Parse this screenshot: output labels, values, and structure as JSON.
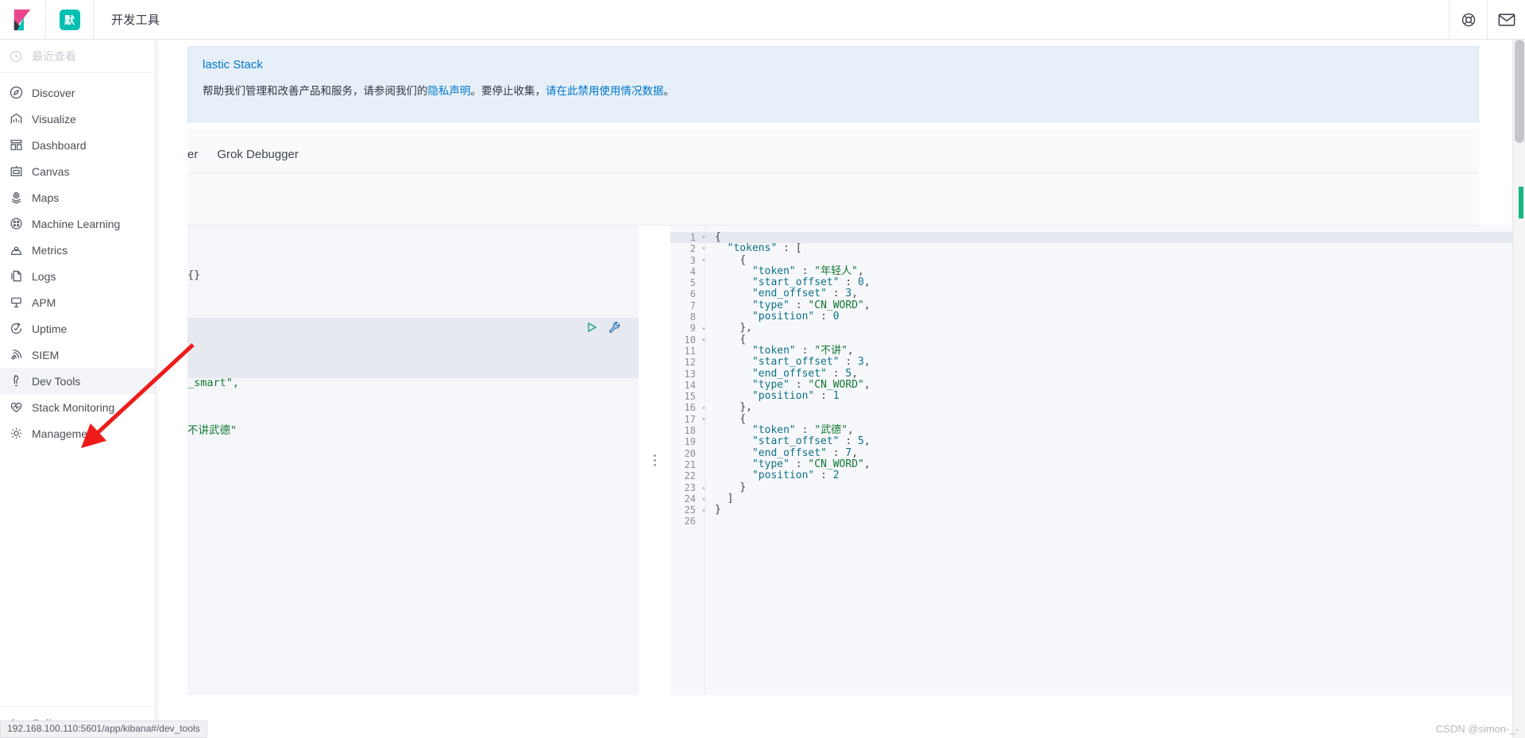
{
  "topbar": {
    "logo_name": "kibana-logo",
    "space_badge": "默",
    "app_title": "开发工具",
    "help_icon": "help-lifebuoy-icon",
    "mail_icon": "mail-icon"
  },
  "nav": {
    "recent_label": "最近查看",
    "recent_icon": "clock-icon",
    "items": [
      {
        "label": "Discover",
        "icon": "compass-icon",
        "active": false
      },
      {
        "label": "Visualize",
        "icon": "bar-chart-icon",
        "active": false
      },
      {
        "label": "Dashboard",
        "icon": "dashboard-icon",
        "active": false
      },
      {
        "label": "Canvas",
        "icon": "canvas-icon",
        "active": false
      },
      {
        "label": "Maps",
        "icon": "map-pin-icon",
        "active": false
      },
      {
        "label": "Machine Learning",
        "icon": "machine-learning-icon",
        "active": false
      },
      {
        "label": "Metrics",
        "icon": "metrics-icon",
        "active": false
      },
      {
        "label": "Logs",
        "icon": "logs-icon",
        "active": false
      },
      {
        "label": "APM",
        "icon": "apm-icon",
        "active": false
      },
      {
        "label": "Uptime",
        "icon": "uptime-icon",
        "active": false
      },
      {
        "label": "SIEM",
        "icon": "siem-icon",
        "active": false
      },
      {
        "label": "Dev Tools",
        "icon": "wrench-icon",
        "active": true
      },
      {
        "label": "Stack Monitoring",
        "icon": "heartbeat-icon",
        "active": false
      },
      {
        "label": "Management",
        "icon": "gear-icon",
        "active": false
      }
    ],
    "collapse_label": "Collapse",
    "collapse_icon": "arrow-left-icon"
  },
  "notice": {
    "title": "lastic Stack",
    "body_pre": "帮助我们管理和改善产品和服务，请参阅我们的",
    "link1": "隐私声明",
    "body_mid": "。要停止收集，",
    "link2": "请在此禁用使用情况数据",
    "body_post": "。"
  },
  "tabs": [
    {
      "label": "er",
      "active": false
    },
    {
      "label": "Grok Debugger",
      "active": false
    }
  ],
  "request_editor": {
    "empty_brace": "{}",
    "line1": "_smart\",",
    "line2": "不讲武德\"",
    "play_icon": "play-icon",
    "wrench_icon": "wrench-icon"
  },
  "response_editor": {
    "lines": [
      {
        "num": "1",
        "fold": "down",
        "text": "{",
        "hl": true
      },
      {
        "num": "2",
        "fold": "down",
        "text": "  \"tokens\" : ["
      },
      {
        "num": "3",
        "fold": "down",
        "text": "    {"
      },
      {
        "num": "4",
        "fold": "",
        "text": "      \"token\" : \"年轻人\","
      },
      {
        "num": "5",
        "fold": "",
        "text": "      \"start_offset\" : 0,"
      },
      {
        "num": "6",
        "fold": "",
        "text": "      \"end_offset\" : 3,"
      },
      {
        "num": "7",
        "fold": "",
        "text": "      \"type\" : \"CN_WORD\","
      },
      {
        "num": "8",
        "fold": "",
        "text": "      \"position\" : 0"
      },
      {
        "num": "9",
        "fold": "up",
        "text": "    },"
      },
      {
        "num": "10",
        "fold": "down",
        "text": "    {"
      },
      {
        "num": "11",
        "fold": "",
        "text": "      \"token\" : \"不讲\","
      },
      {
        "num": "12",
        "fold": "",
        "text": "      \"start_offset\" : 3,"
      },
      {
        "num": "13",
        "fold": "",
        "text": "      \"end_offset\" : 5,"
      },
      {
        "num": "14",
        "fold": "",
        "text": "      \"type\" : \"CN_WORD\","
      },
      {
        "num": "15",
        "fold": "",
        "text": "      \"position\" : 1"
      },
      {
        "num": "16",
        "fold": "up",
        "text": "    },"
      },
      {
        "num": "17",
        "fold": "down",
        "text": "    {"
      },
      {
        "num": "18",
        "fold": "",
        "text": "      \"token\" : \"武德\","
      },
      {
        "num": "19",
        "fold": "",
        "text": "      \"start_offset\" : 5,"
      },
      {
        "num": "20",
        "fold": "",
        "text": "      \"end_offset\" : 7,"
      },
      {
        "num": "21",
        "fold": "",
        "text": "      \"type\" : \"CN_WORD\","
      },
      {
        "num": "22",
        "fold": "",
        "text": "      \"position\" : 2"
      },
      {
        "num": "23",
        "fold": "up",
        "text": "    }"
      },
      {
        "num": "24",
        "fold": "up",
        "text": "  ]"
      },
      {
        "num": "25",
        "fold": "up",
        "text": "}"
      },
      {
        "num": "26",
        "fold": "",
        "text": ""
      }
    ]
  },
  "statusbar": {
    "url": "192.168.100.110:5601/app/kibana#/dev_tools"
  },
  "watermark": {
    "text": "CSDN @simon-_-"
  }
}
